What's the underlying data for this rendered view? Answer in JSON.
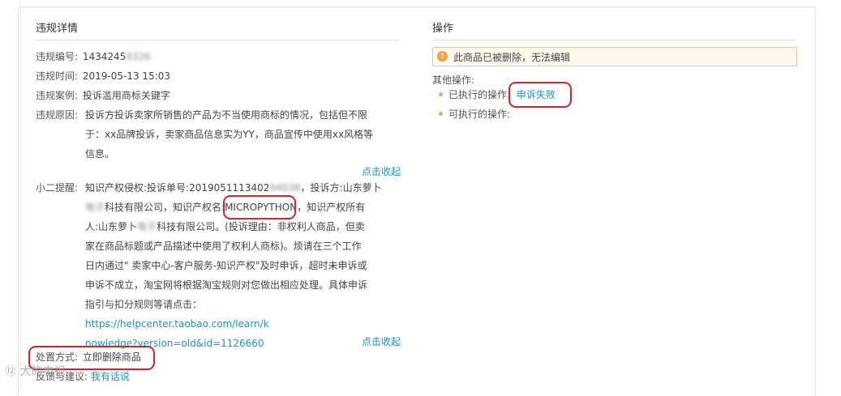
{
  "left": {
    "title": "违规详情",
    "violation_no_label": "违规编号:",
    "violation_no_visible": "1434245",
    "violation_no_masked": "8326",
    "violation_time_label": "违规时间:",
    "violation_time": "2019-05-13 15:03",
    "case_label": "违规案例:",
    "case_value": "投诉滥用商标关键字",
    "reason_label": "违规原因:",
    "reason_line1": "投诉方投诉卖家所销售的产品为不当使用商标的情况，包括但不限",
    "reason_line2": "于：xx品牌投诉，卖家商品信息实为YY，商品宣传中使用xx风格等",
    "reason_line3": "信息。",
    "collapse_1": "点击收起",
    "tip_label": "小二提醒:",
    "tip_line1_a": "知识产权侵权:投诉单号:2019051113402",
    "tip_line1_masked": "94038",
    "tip_line1_b": "，投诉方:山东萝卜",
    "tip_line2_masked": "电子",
    "tip_line2_a": "科技有限公司，知识产权名:",
    "tip_ip_name": "MICROPYTHON",
    "tip_line2_b": "，知识产权所有",
    "tip_line3_a": "人:山东萝卜",
    "tip_line3_masked": "电子",
    "tip_line3_b": "科技有限公司。(投诉理由：非权利人商品，但卖",
    "tip_line4": "家在商品标题或产品描述中使用了权利人商标)。烦请在三个工作",
    "tip_line5": "日内通过\" 卖家中心-客户服务-知识产权\"及时申诉，超时未申诉或",
    "tip_line6": "申诉不成立，淘宝网将根据淘宝规则对您做出相应处理。具体申诉",
    "tip_line7_a": "指引与扣分规则等请点击：",
    "tip_link_1": "https://helpcenter.taobao.com/learn/k",
    "tip_link_2": "nowledge?version=old&id=1126660",
    "collapse_2": "点击收起",
    "handling_label": "处置方式:",
    "handling_value": "立即删除商品",
    "feedback_label": "反馈与建议:",
    "feedback_link": "我有话说"
  },
  "right": {
    "title": "操作",
    "warning_text": "此商品已被删除，无法编辑",
    "other_ops_label": "其他操作:",
    "executed_label": "已执行的操作:",
    "executed_value": "申诉失败",
    "executable_label": "可执行的操作:"
  },
  "watermark": "⑫ 犬的电视"
}
